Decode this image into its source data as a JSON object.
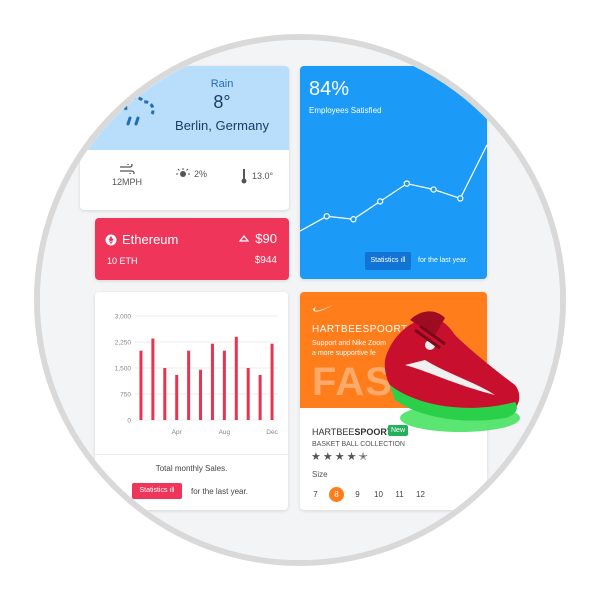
{
  "weather": {
    "condition": "Rain",
    "temperature": "8°",
    "location": "Berlin, Germany",
    "wind": "12MPH",
    "precip": "2%",
    "thermo": "13.0°"
  },
  "ethereum": {
    "name": "Ethereum",
    "price": "$90",
    "amount": "10 ETH",
    "value": "$944"
  },
  "employees": {
    "percent": "84%",
    "label": "Employees Satisfied",
    "stats_button": "Statistics ıll",
    "period": "for the last year."
  },
  "sales": {
    "title": "Total monthly Sales.",
    "stats_button": "Statistics ıll",
    "period": "for the last year."
  },
  "nike": {
    "brand": "HARTBEESPOORT",
    "tagline1": "Support and Nike Zoom",
    "tagline2": "a more supportive fe",
    "big_text": "FAS",
    "product_prefix": "HARTBEE",
    "product_suffix": "SPOORT",
    "new_badge": "New",
    "collection": "BASKET BALL COLLECTION",
    "rating": 4,
    "size_label": "Size",
    "sizes": [
      "7",
      "8",
      "9",
      "10",
      "11",
      "12"
    ],
    "selected_size": "8"
  },
  "colors": {
    "weather_bg": "#b9defb",
    "eth_bg": "#f0355a",
    "employees_bg": "#1b9bf7",
    "bar": "#e8354f",
    "nike_orange": "#ff7d1a"
  },
  "chart_data": [
    {
      "type": "line",
      "x": [
        1,
        2,
        3,
        4,
        5,
        6,
        7,
        8
      ],
      "values": [
        1.0,
        1.5,
        1.4,
        2.0,
        2.6,
        2.4,
        2.1,
        3.9
      ],
      "title": "",
      "xlabel": "",
      "ylabel": "",
      "grid": false
    },
    {
      "type": "bar",
      "categories": [
        "",
        "",
        "",
        "Apr",
        "",
        "",
        "",
        "Aug",
        "",
        "",
        "",
        "Dec"
      ],
      "values": [
        2000,
        2350,
        1500,
        1300,
        2000,
        1450,
        2200,
        2000,
        2400,
        1500,
        1300,
        2200
      ],
      "ylim": [
        0,
        3000
      ],
      "yticks": [
        "0",
        "750",
        "1,500",
        "2,250",
        "3,000"
      ],
      "yticks_values": [
        0,
        750,
        1500,
        2250,
        3000
      ],
      "title": "Total monthly Sales.",
      "xlabel": "",
      "ylabel": "",
      "grid": true
    }
  ]
}
